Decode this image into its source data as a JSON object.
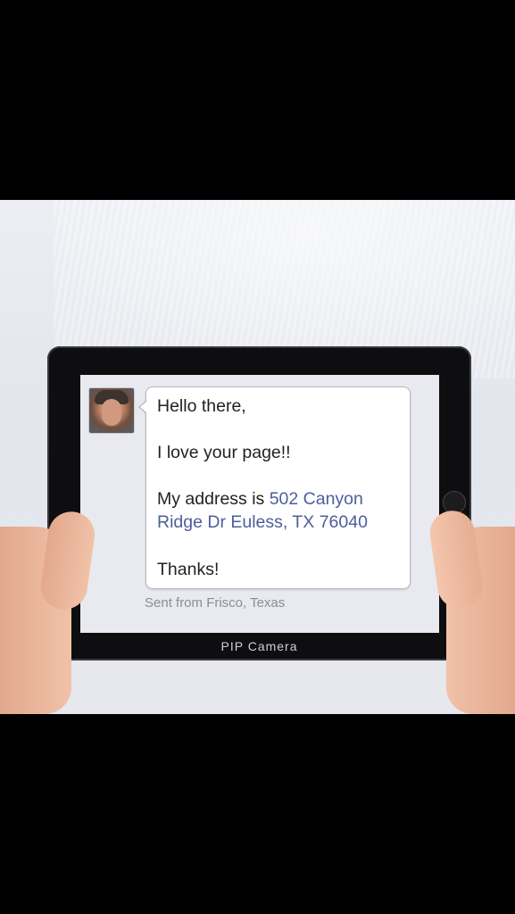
{
  "screen": {
    "message_lines": {
      "greeting": "Hello there,",
      "line2": "I love your page!!",
      "line3_prefix": "My address is ",
      "line3_link_part1": "502 Canyon",
      "line3_link_part2": "Ridge Dr Euless, TX 76040",
      "closing": "Thanks!"
    },
    "sent_from": "Sent from Frisco, Texas"
  },
  "device": {
    "brand_label": "PIP Camera"
  },
  "colors": {
    "link": "#4c5f9a",
    "background": "#000000",
    "screen_bg": "#e8eaef"
  }
}
